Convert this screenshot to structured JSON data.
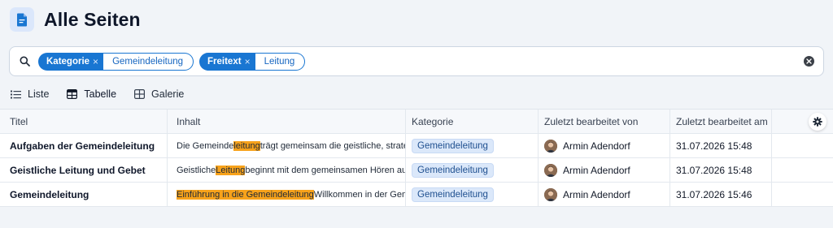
{
  "page": {
    "title": "Alle Seiten",
    "icon": "document-icon"
  },
  "search": {
    "filters": [
      {
        "key": "Kategorie",
        "value": "Gemeindeleitung"
      },
      {
        "key": "Freitext",
        "value": "Leitung"
      }
    ],
    "remove_symbol": "×",
    "icons": {
      "search": "search-icon",
      "clear": "clear-icon"
    }
  },
  "views": [
    {
      "label": "Liste",
      "icon": "list-icon"
    },
    {
      "label": "Tabelle",
      "icon": "table-icon",
      "active": true
    },
    {
      "label": "Galerie",
      "icon": "gallery-icon"
    }
  ],
  "table": {
    "columns": [
      "Titel",
      "Inhalt",
      "Kategorie",
      "Zuletzt bearbeitet von",
      "Zuletzt bearbeitet am"
    ],
    "rows": [
      {
        "title": "Aufgaben der Gemeindeleitung",
        "content_pre": "Die Gemeinde",
        "content_hl": "leitung",
        "content_post": " trägt gemeinsam die geistliche, strateg",
        "category": "Gemeindeleitung",
        "editor": "Armin Adendorf",
        "edited": "31.07.2026 15:48"
      },
      {
        "title": "Geistliche Leitung und Gebet",
        "content_pre": "Geistliche ",
        "content_hl": "Leitung",
        "content_post": " beginnt mit dem gemeinsamen Hören auf G",
        "category": "Gemeindeleitung",
        "editor": "Armin Adendorf",
        "edited": "31.07.2026 15:48"
      },
      {
        "title": "Gemeindeleitung",
        "content_pre": "",
        "content_hl": "Einführung in die Gemeindeleitung",
        "content_post": " Willkommen in der Geme",
        "category": "Gemeindeleitung",
        "editor": "Armin Adendorf",
        "edited": "31.07.2026 15:46"
      }
    ],
    "settings_icon": "gear-icon"
  },
  "colors": {
    "accent": "#1976d2",
    "highlight": "#f7a21b",
    "background": "#f1f4f8"
  }
}
